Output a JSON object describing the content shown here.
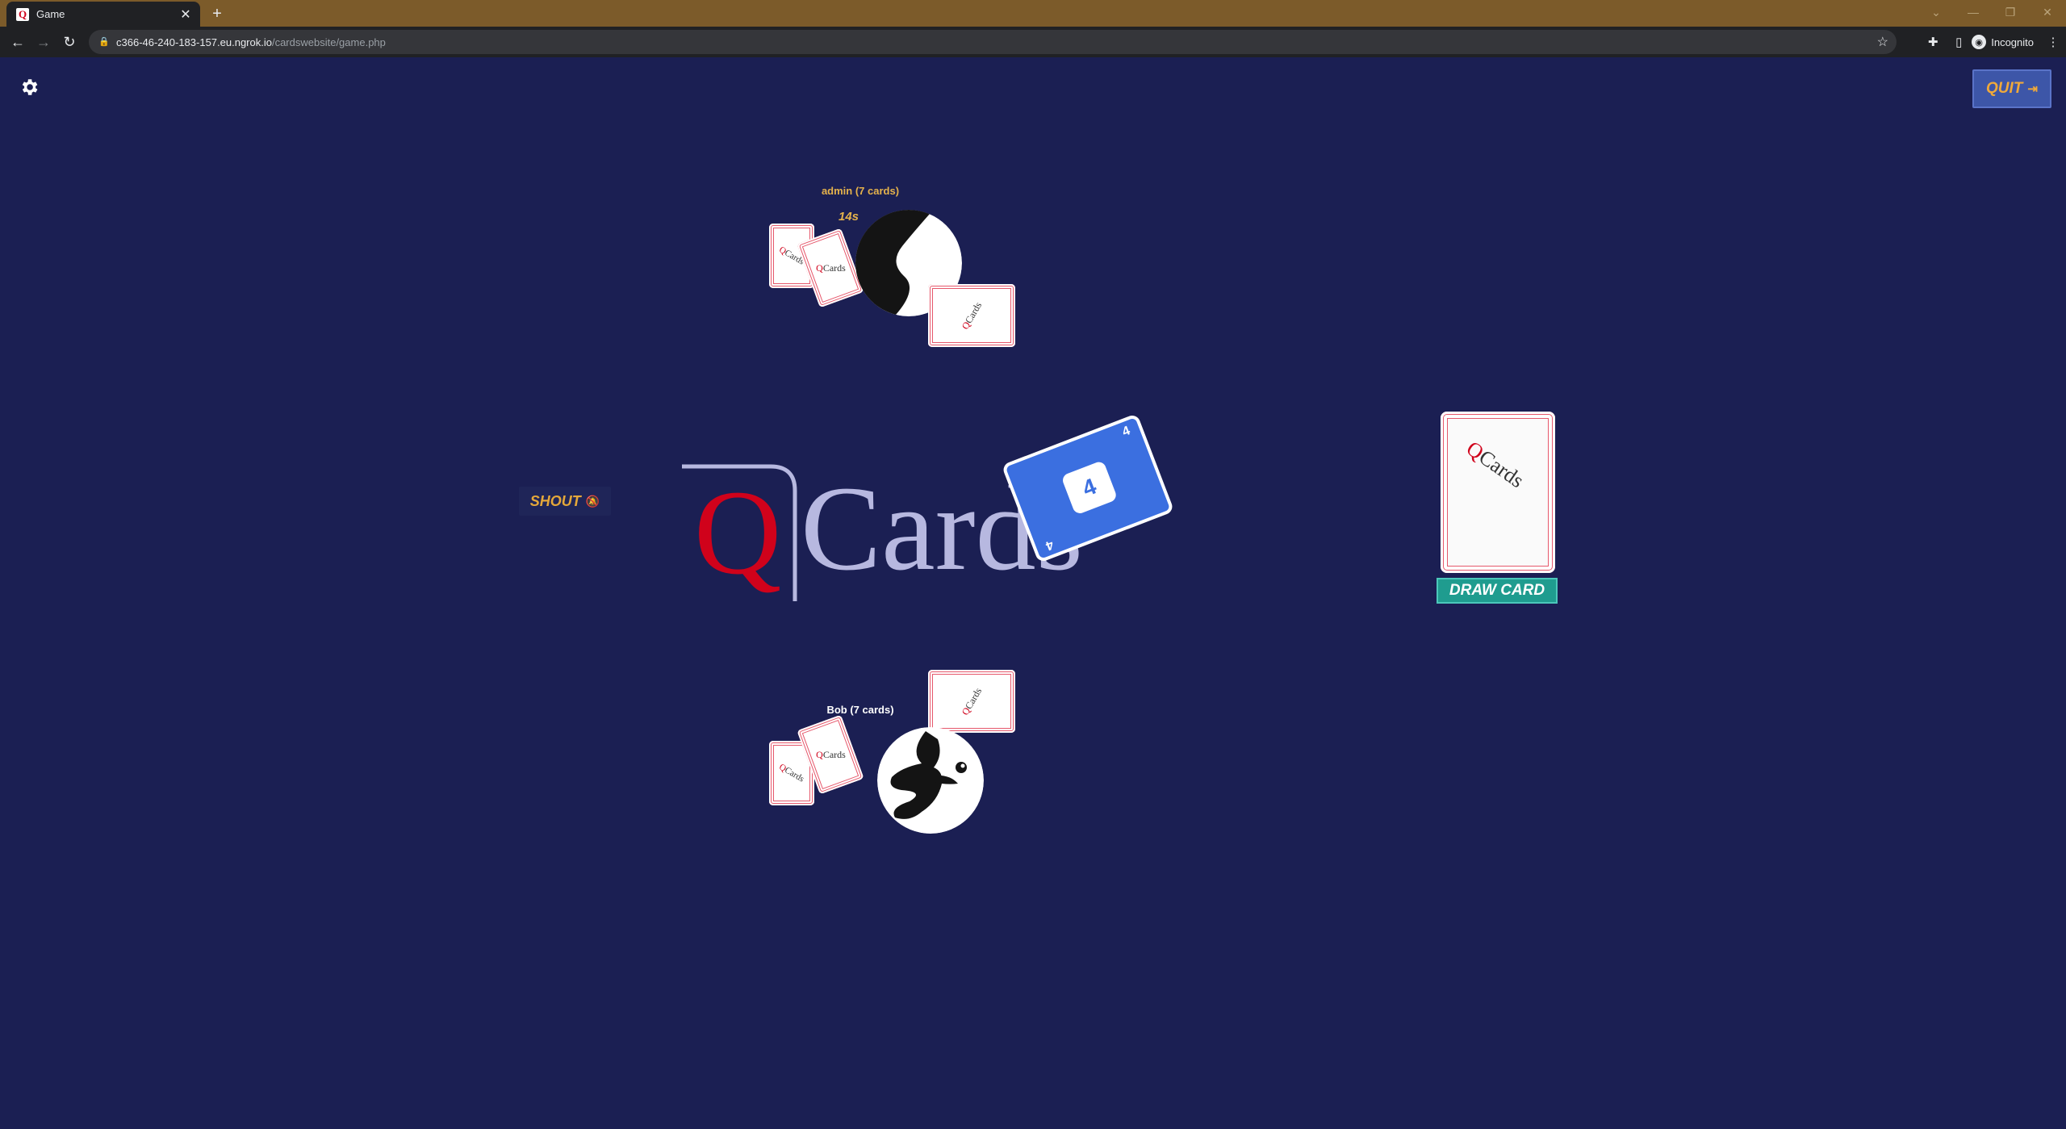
{
  "browser": {
    "tab_title": "Game",
    "tab_favicon": "Q",
    "url_host": "c366-46-240-183-157.eu.ngrok.io",
    "url_path": "/cardswebsite/game.php",
    "incognito_label": "Incognito"
  },
  "game": {
    "quit_label": "QUIT",
    "shout_label": "SHOUT",
    "draw_label": "DRAW CARD",
    "logo": {
      "q": "Q",
      "cards": "Cards"
    },
    "card_back": {
      "q": "Q",
      "cards": "Cards"
    },
    "played_card": {
      "value": "4",
      "color": "#3b6fe0"
    },
    "players": [
      {
        "name": "admin (7 cards)",
        "timer": "14s",
        "name_color": "#e5b24b"
      },
      {
        "name": "Bob (7 cards)",
        "name_color": "#ffffff"
      }
    ]
  },
  "colors": {
    "background": "#1b1f53",
    "accent_gold": "#e5a83a",
    "draw_button": "#1f9c8f",
    "quit_button": "#3d56a8",
    "card_border": "#e6586c",
    "logo_red": "#d0021b",
    "logo_lavender": "#b7b8e0"
  }
}
